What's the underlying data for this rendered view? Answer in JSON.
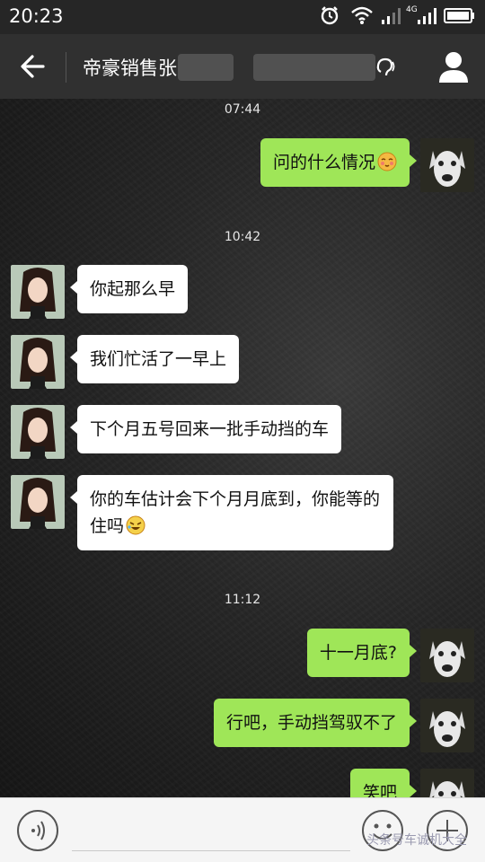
{
  "status_bar": {
    "time": "20:23",
    "network_label": "4G"
  },
  "header": {
    "title_visible": "帝豪销售张"
  },
  "messages": [
    {
      "type": "timestamp",
      "text": "07:44"
    },
    {
      "type": "out",
      "text": "问的什么情况",
      "emoji": "face-emoji"
    },
    {
      "type": "timestamp",
      "text": "10:42"
    },
    {
      "type": "in",
      "text": "你起那么早"
    },
    {
      "type": "in",
      "text": "我们忙活了一早上"
    },
    {
      "type": "in",
      "text": "下个月五号回来一批手动挡的车"
    },
    {
      "type": "in",
      "text": "你的车估计会下个月月底到，你能等的住吗",
      "emoji": "laugh-emoji"
    },
    {
      "type": "timestamp",
      "text": "11:12"
    },
    {
      "type": "out",
      "text": "十一月底?"
    },
    {
      "type": "out",
      "text": "行吧，手动挡驾驭不了"
    },
    {
      "type": "out",
      "text": "笑吧"
    }
  ],
  "input_bar": {
    "watermark": "头条号车诚机大全"
  },
  "colors": {
    "outgoing_bubble": "#9fe658",
    "incoming_bubble": "#ffffff",
    "title_bar": "#303030",
    "status_bar": "#262626",
    "input_bar": "#f5f5f5"
  }
}
